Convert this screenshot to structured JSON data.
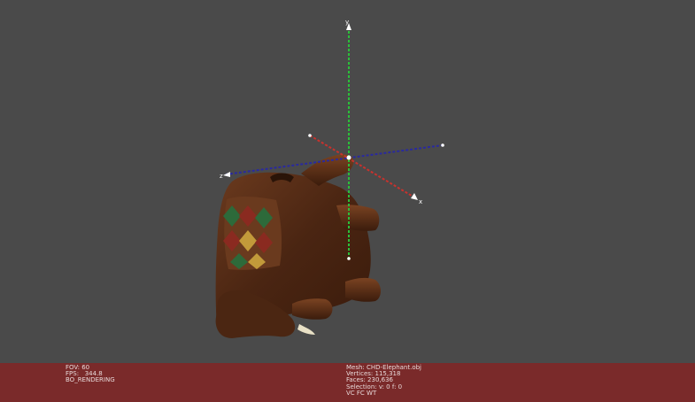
{
  "viewport": {
    "axes": {
      "x_label": "x",
      "y_label": "y",
      "z_label": "z"
    },
    "colors": {
      "background": "#4a4a4a",
      "x_axis": "#c8322d",
      "y_axis": "#2bbf3a",
      "z_axis": "#2a2a9e",
      "status_bar": "#7a2a2a"
    },
    "model": "elephant"
  },
  "status": {
    "left": {
      "fov": "FOV: 60",
      "fps": "FPS:   344.8",
      "mode": "BO_RENDERING"
    },
    "right": {
      "mesh": "Mesh: CHD-Elephant.obj",
      "vertices": "Vertices: 115,318",
      "faces": "Faces: 230,636",
      "selection": "Selection: v: 0 f: 0",
      "flags": "VC FC WT"
    }
  }
}
